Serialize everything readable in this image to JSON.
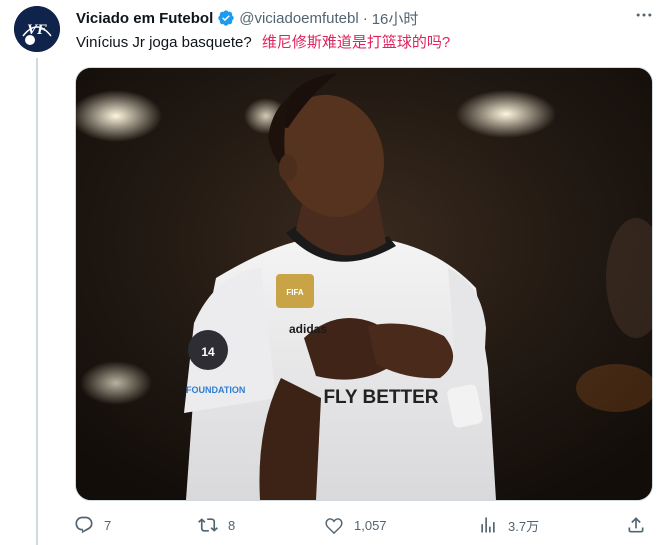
{
  "tweet": {
    "author": {
      "display_name": "Viciado em Futebol",
      "handle": "@viciadoemfutebl",
      "avatar_text": "VF",
      "verified": true
    },
    "separator": "·",
    "time": "16小时",
    "text": "Vinícius Jr joga basquete?",
    "translation": "维尼修斯难道是打篮球的吗?",
    "media": {
      "type": "photo",
      "visible_text": [
        "FLY BETTER",
        "14",
        "FOUNDATION",
        "adidas",
        "FIFA"
      ]
    },
    "actions": {
      "reply": {
        "icon": "reply-icon",
        "count": "7"
      },
      "retweet": {
        "icon": "retweet-icon",
        "count": "8"
      },
      "like": {
        "icon": "heart-icon",
        "count": "1,057"
      },
      "views": {
        "icon": "views-icon",
        "count": "3.7万"
      },
      "share": {
        "icon": "share-icon"
      }
    }
  },
  "colors": {
    "accent": "#1d9bf0",
    "text": "#0f1419",
    "muted": "#536471",
    "translation": "#e0245e",
    "thread_line": "#cfd9de"
  }
}
